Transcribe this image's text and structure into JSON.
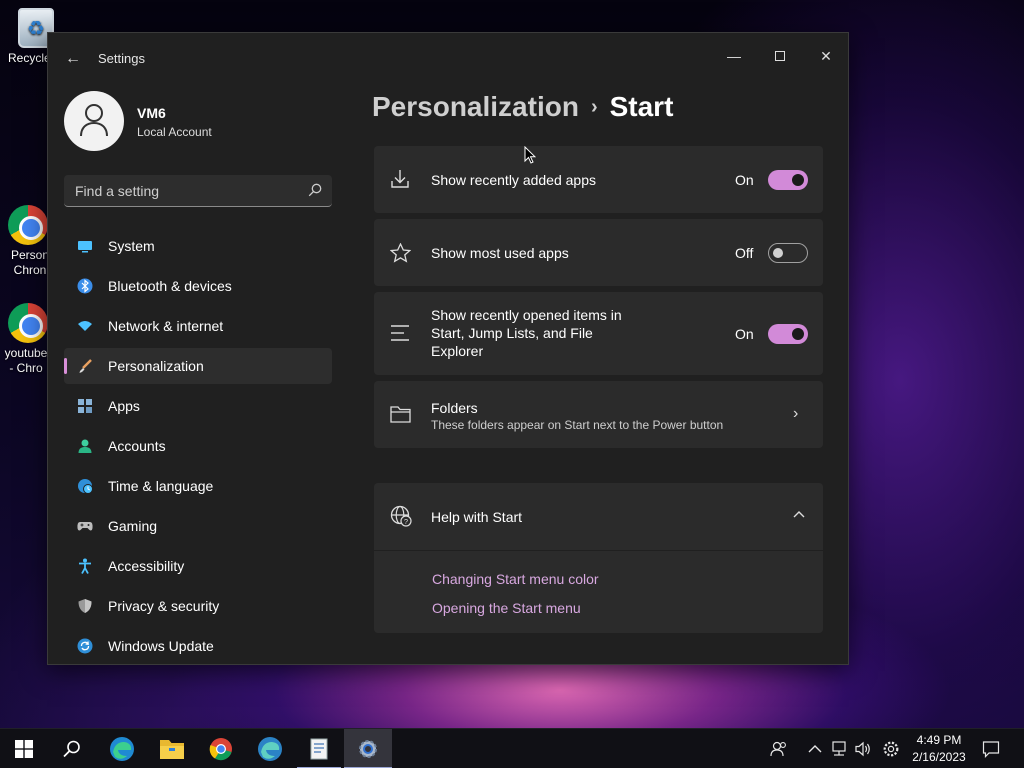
{
  "desktop": {
    "icons": [
      {
        "label": "Recycle"
      },
      {
        "label": "Person Chron"
      },
      {
        "label": "youtube - Chro"
      }
    ]
  },
  "window": {
    "title": "Settings",
    "back_label": "←",
    "minimize_label": "—",
    "close_label": "✕"
  },
  "profile": {
    "name": "VM6",
    "account_type": "Local Account"
  },
  "search": {
    "placeholder": "Find a setting"
  },
  "nav": {
    "items": [
      {
        "label": "System",
        "icon": "monitor-icon"
      },
      {
        "label": "Bluetooth & devices",
        "icon": "bluetooth-icon"
      },
      {
        "label": "Network & internet",
        "icon": "wifi-icon"
      },
      {
        "label": "Personalization",
        "icon": "brush-icon",
        "active": true
      },
      {
        "label": "Apps",
        "icon": "apps-icon"
      },
      {
        "label": "Accounts",
        "icon": "person-icon"
      },
      {
        "label": "Time & language",
        "icon": "globe-clock-icon"
      },
      {
        "label": "Gaming",
        "icon": "gamepad-icon"
      },
      {
        "label": "Accessibility",
        "icon": "accessibility-icon"
      },
      {
        "label": "Privacy & security",
        "icon": "shield-icon"
      },
      {
        "label": "Windows Update",
        "icon": "update-icon"
      }
    ]
  },
  "breadcrumb": {
    "parent": "Personalization",
    "separator": "›",
    "current": "Start"
  },
  "settings": {
    "recent_apps": {
      "label": "Show recently added apps",
      "state": "On"
    },
    "most_used": {
      "label": "Show most used apps",
      "state": "Off"
    },
    "recent_items": {
      "label_line1": "Show recently opened items in",
      "label_line2": "Start, Jump Lists, and File",
      "label_line3": "Explorer",
      "state": "On"
    },
    "folders": {
      "label": "Folders",
      "description": "These folders appear on Start next to the Power button"
    }
  },
  "help": {
    "title": "Help with Start",
    "links": [
      "Changing Start menu color",
      "Opening the Start menu"
    ]
  },
  "taskbar": {
    "time": "4:49 PM",
    "date": "2/16/2023"
  },
  "colors": {
    "accent": "#d28ad8",
    "window_bg": "#202020",
    "card_bg": "#2b2b2b",
    "link": "#d8a8e0"
  }
}
